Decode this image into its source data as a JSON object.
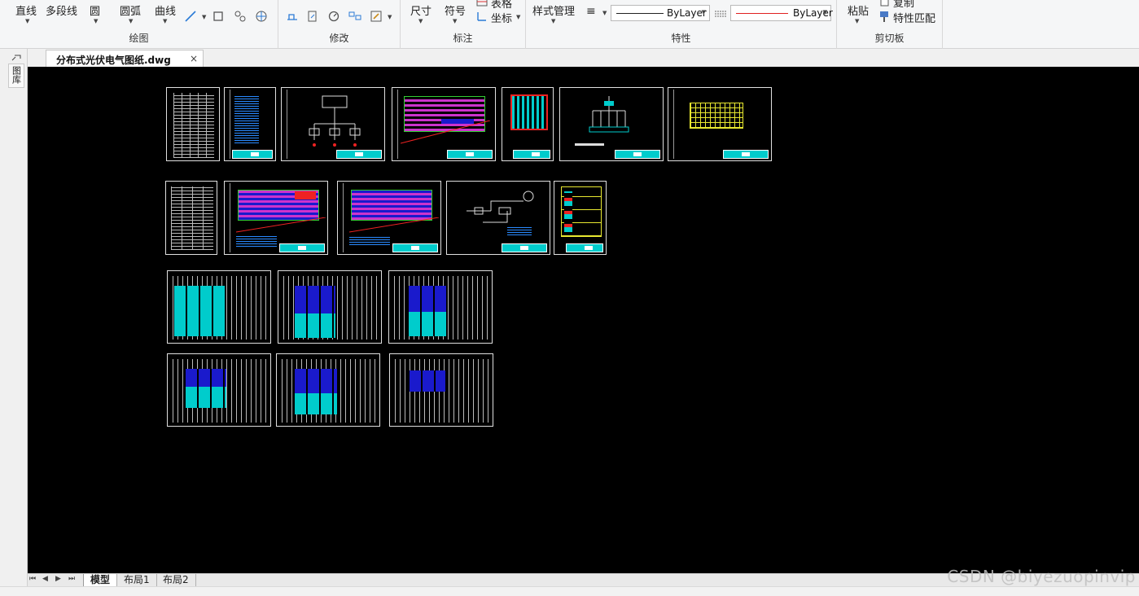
{
  "ribbon": {
    "draw": {
      "label": "绘图",
      "tools": [
        "直线",
        "多段线",
        "圆",
        "圆弧",
        "曲线"
      ]
    },
    "modify": {
      "label": "修改"
    },
    "annotate": {
      "label": "标注",
      "dimension": "尺寸",
      "symbol": "符号",
      "table": "表格",
      "coordinate": "坐标"
    },
    "properties": {
      "label": "特性",
      "style_manager": "样式管理",
      "linetype": "ByLayer",
      "color": "ByLayer"
    },
    "clipboard": {
      "label": "剪切板",
      "paste": "粘贴",
      "copy": "复制",
      "match_properties": "特性匹配"
    }
  },
  "left_strip": {
    "tab_label": "图库"
  },
  "document": {
    "tab_name": "分布式光伏电气图纸.dwg",
    "close": "×"
  },
  "layouts": {
    "nav": [
      "⏮",
      "◀",
      "▶",
      "⏭"
    ],
    "tabs": [
      "模型",
      "布局1",
      "布局2"
    ],
    "active": "模型"
  },
  "watermark": "CSDN @biyezuopinvip",
  "colors": {
    "canvas": "#000000",
    "cyan": "#00cccc",
    "blue": "#1a1acc",
    "magenta": "#cc33cc",
    "red": "#ee2222",
    "yellow": "#e8e830"
  }
}
